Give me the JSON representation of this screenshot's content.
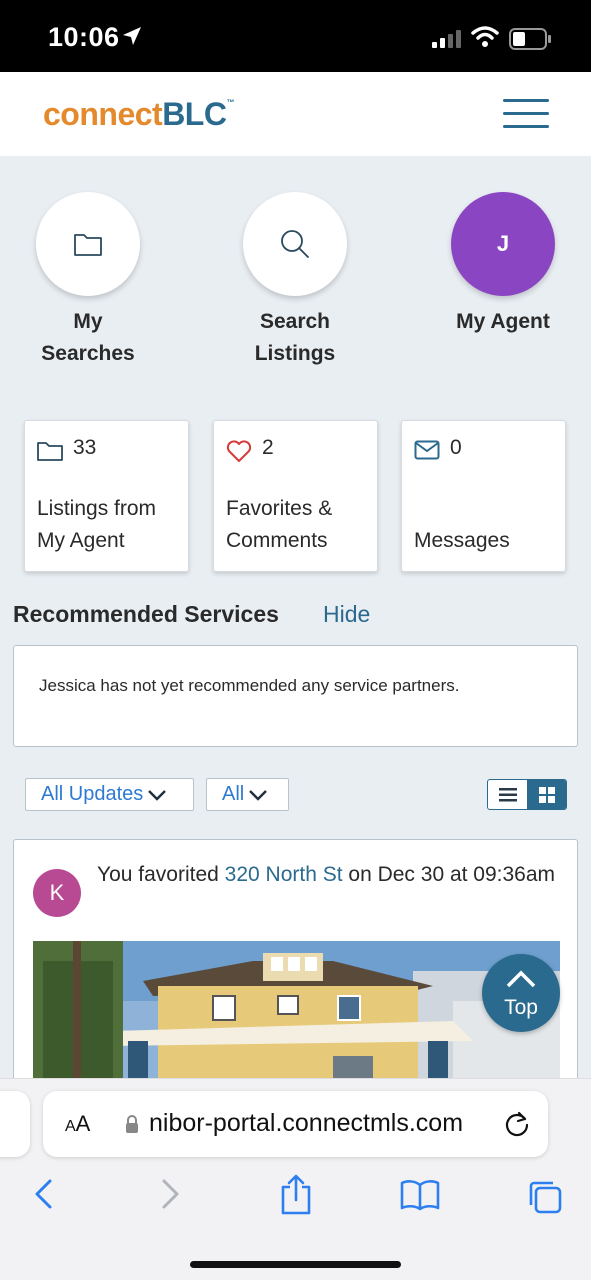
{
  "status_bar": {
    "time": "10:06"
  },
  "header": {
    "logo_part1": "connect",
    "logo_part2": "BLC",
    "logo_tm": "™"
  },
  "nav_circles": [
    {
      "label": "My Searches",
      "icon": "folder-icon"
    },
    {
      "label": "Search Listings",
      "icon": "search-icon"
    },
    {
      "label": "My Agent",
      "initial": "J"
    }
  ],
  "stat_cards": [
    {
      "count": "33",
      "label": "Listings from My Agent",
      "icon": "folder-icon"
    },
    {
      "count": "2",
      "label": "Favorites & Comments",
      "icon": "heart-icon"
    },
    {
      "count": "0",
      "label": "Messages",
      "icon": "mail-icon"
    }
  ],
  "recommended": {
    "title": "Recommended Services",
    "hide_label": "Hide",
    "empty_text": "Jessica has not yet recommended any service partners."
  },
  "filters": {
    "updates_label": "All Updates",
    "type_label": "All"
  },
  "feed": [
    {
      "avatar_initial": "K",
      "text_before": "You favorited ",
      "link_text": "320 North St",
      "text_after": " on Dec 30 at 09:36am"
    }
  ],
  "top_button": {
    "label": "Top"
  },
  "browser": {
    "aa_small": "A",
    "aa_large": "A",
    "url": "nibor-portal.connectmls.com"
  },
  "colors": {
    "brand_blue": "#2b6a8f",
    "brand_orange": "#e58a2c",
    "agent_purple": "#8a45c2",
    "link_blue": "#2e7ad1",
    "heart_red": "#d63c3c",
    "avatar_pink": "#b84a93"
  }
}
